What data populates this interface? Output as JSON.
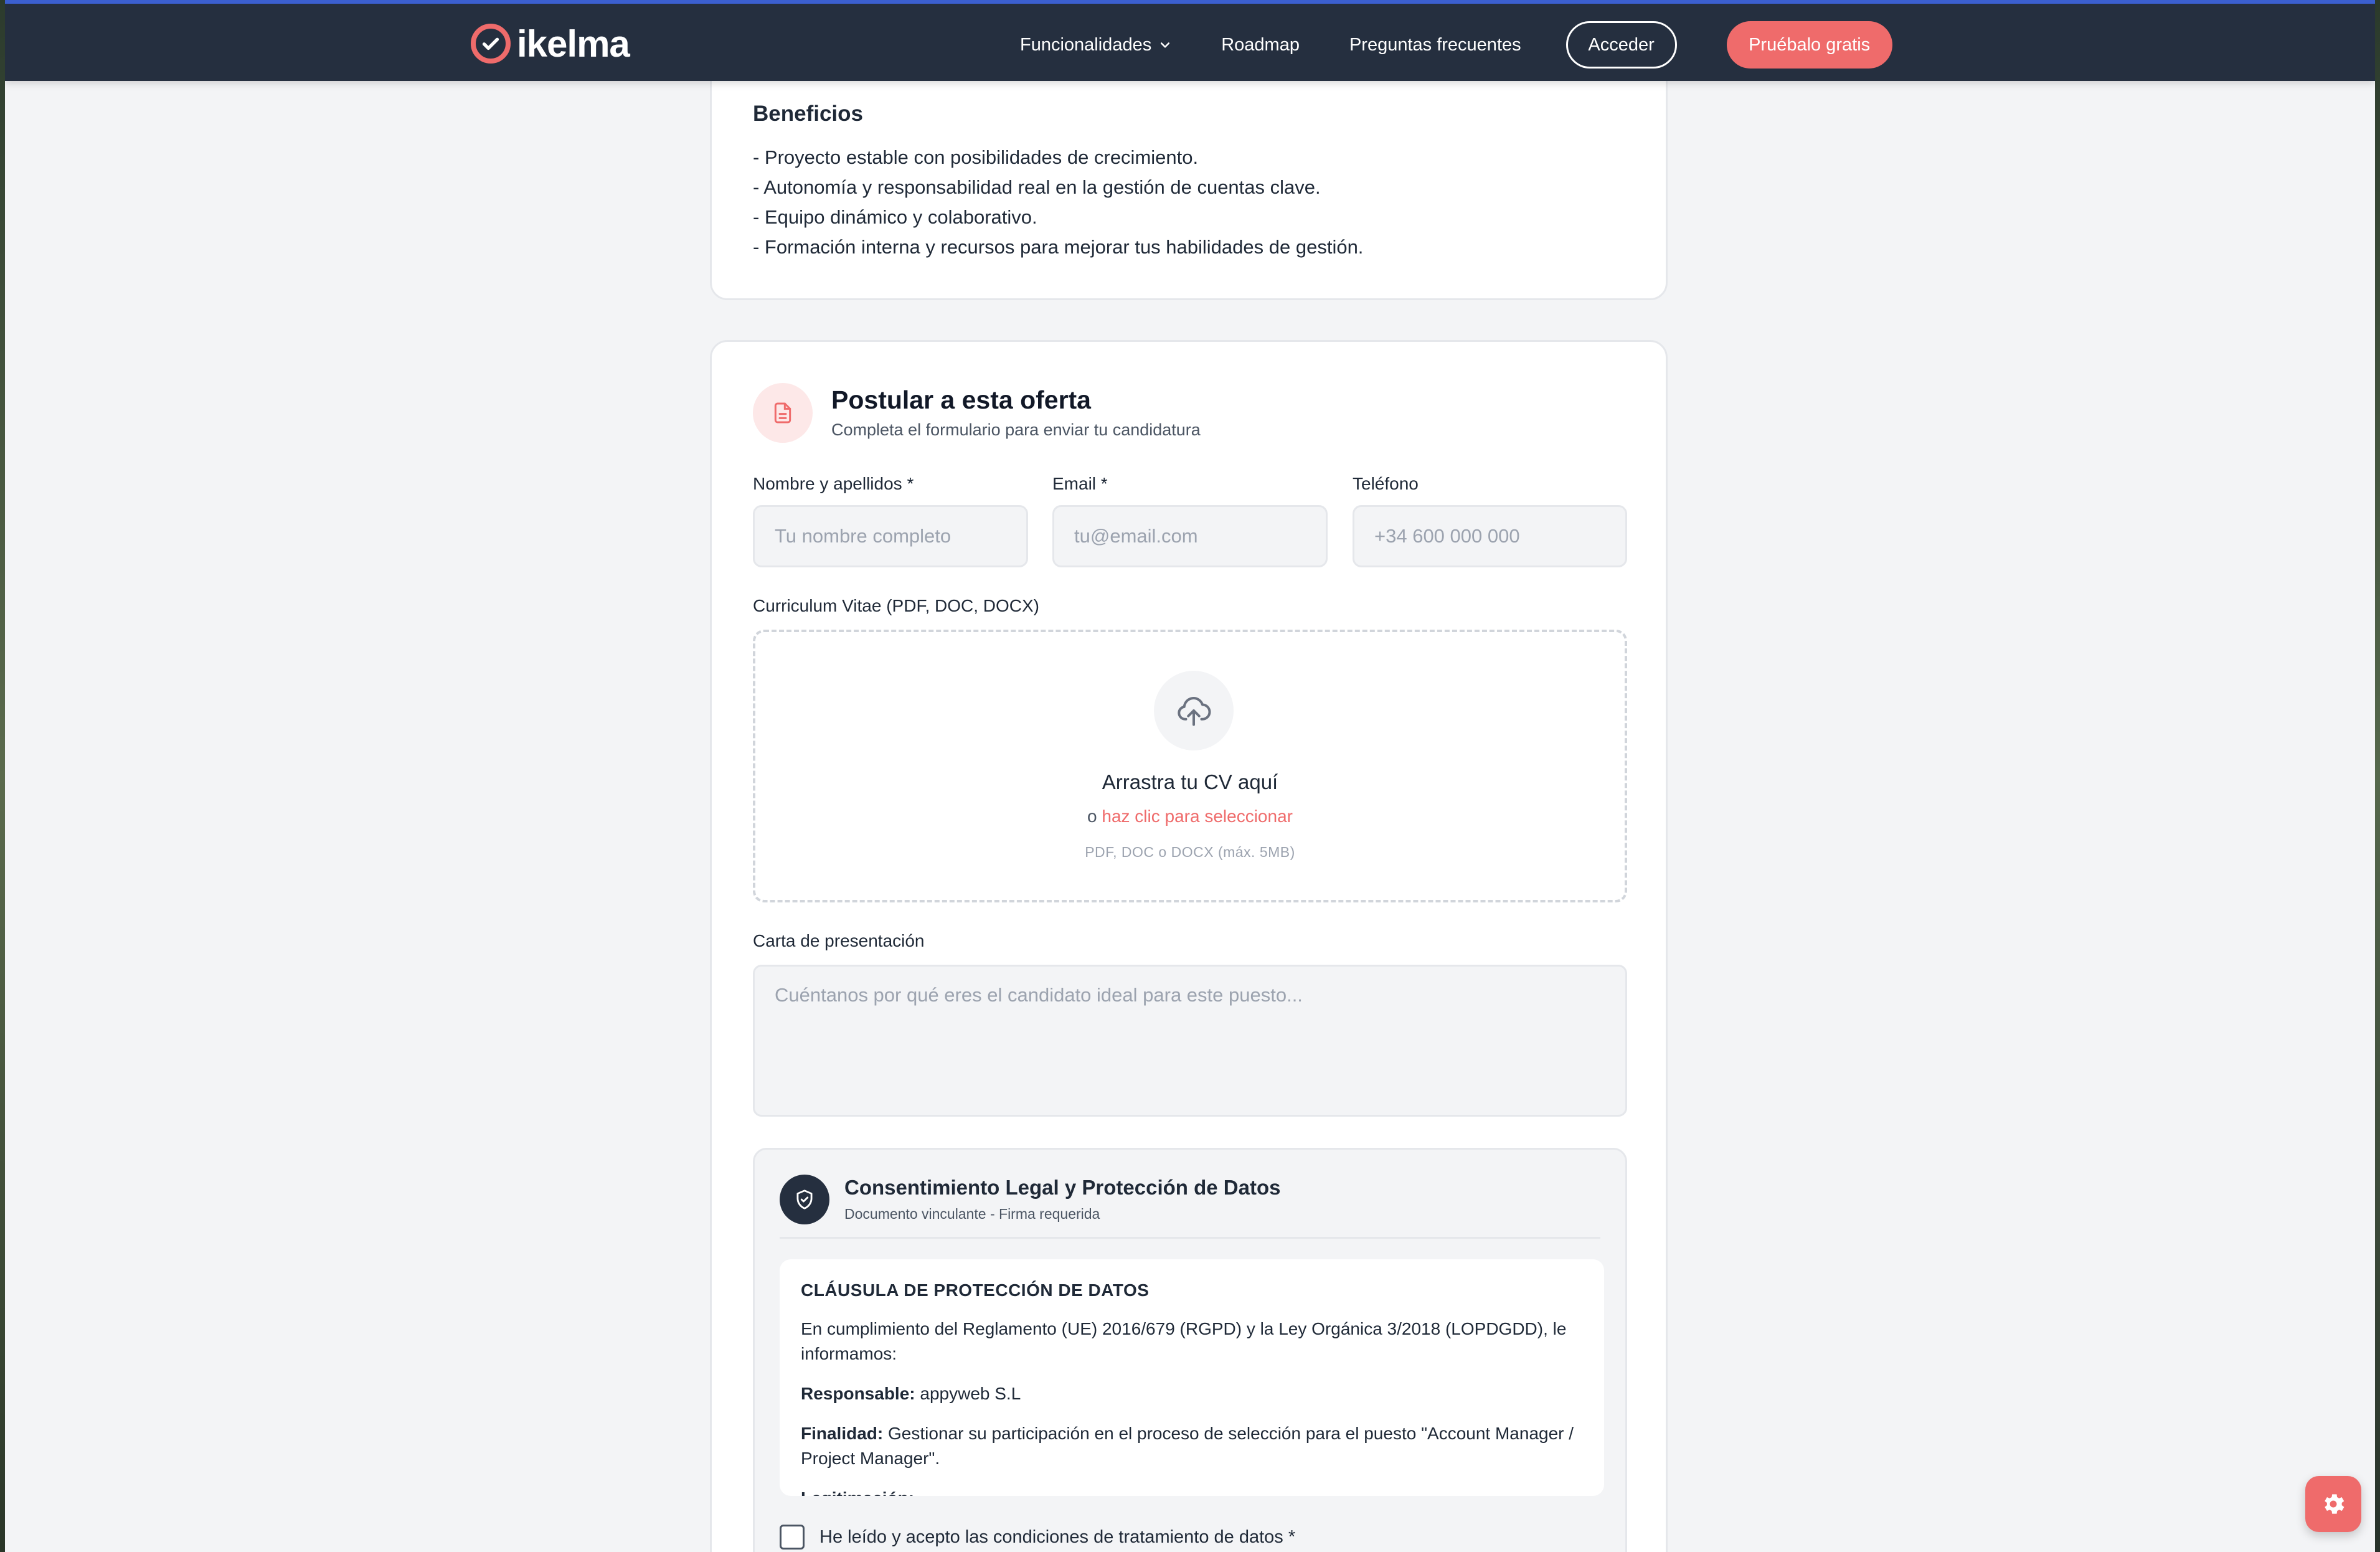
{
  "brand": {
    "name": "ikelma",
    "accent": "#ef6b6b",
    "nav_bg": "#252f3f"
  },
  "nav": {
    "features": "Funcionalidades",
    "roadmap": "Roadmap",
    "faq": "Preguntas frecuentes",
    "login": "Acceder",
    "trial": "Pruébalo gratis"
  },
  "benefits": {
    "title": "Beneficios",
    "items": [
      "- Proyecto estable con posibilidades de crecimiento.",
      "- Autonomía y responsabilidad real en la gestión de cuentas clave.",
      "- Equipo dinámico y colaborativo.",
      "- Formación interna y recursos para mejorar tus habilidades de gestión."
    ]
  },
  "form": {
    "title": "Postular a esta oferta",
    "subtitle": "Completa el formulario para enviar tu candidatura",
    "name_label": "Nombre y apellidos *",
    "name_placeholder": "Tu nombre completo",
    "email_label": "Email *",
    "email_placeholder": "tu@email.com",
    "phone_label": "Teléfono",
    "phone_placeholder": "+34 600 000 000",
    "cv_label": "Curriculum Vitae (PDF, DOC, DOCX)",
    "drop_title": "Arrastra tu CV aquí",
    "drop_or": "o ",
    "drop_link": "haz clic para seleccionar",
    "drop_hint": "PDF, DOC o DOCX (máx. 5MB)",
    "cover_label": "Carta de presentación",
    "cover_placeholder": "Cuéntanos por qué eres el candidato ideal para este puesto..."
  },
  "legal": {
    "title": "Consentimiento Legal y Protección de Datos",
    "subtitle": "Documento vinculante - Firma requerida",
    "clause_title": "CLÁUSULA DE PROTECCIÓN DE DATOS",
    "intro": "En cumplimiento del Reglamento (UE) 2016/679 (RGPD) y la Ley Orgánica 3/2018 (LOPDGDD), le informamos:",
    "responsible_label": "Responsable:",
    "responsible_value": " appyweb S.L",
    "purpose_label": "Finalidad:",
    "purpose_value": " Gestionar su participación en el proceso de selección para el puesto \"Account Manager / Project Manager\".",
    "legitimation_label": "Legitimación:",
    "consent_text": "He leído y acepto las condiciones de tratamiento de datos *"
  },
  "icons": {
    "logo": "check-circle-icon",
    "nav_dropdown": "chevron-down-icon",
    "form_header": "document-icon",
    "upload": "cloud-upload-icon",
    "legal": "shield-check-icon",
    "settings": "gear-icon"
  }
}
